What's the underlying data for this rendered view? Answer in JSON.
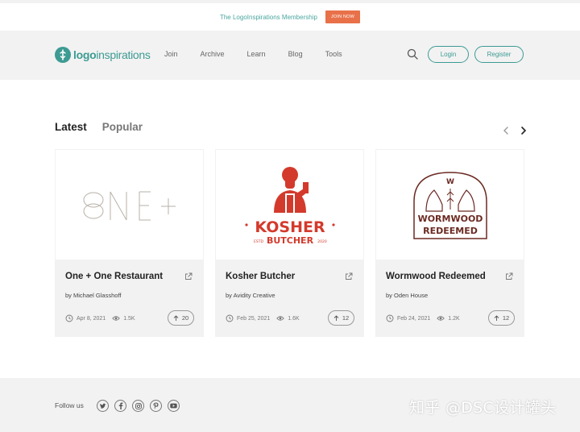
{
  "promo": {
    "text": "The LogoInspirations Membership",
    "button": "JOIN NOW"
  },
  "header": {
    "logo_part1": "logo",
    "logo_part2": "inspirations",
    "nav": [
      "Join",
      "Archive",
      "Learn",
      "Blog",
      "Tools"
    ],
    "login": "Login",
    "register": "Register"
  },
  "tabs": {
    "latest": "Latest",
    "popular": "Popular"
  },
  "cards": [
    {
      "title": "One + One Restaurant",
      "author": "by Michael Glasshoff",
      "date": "Apr 8, 2021",
      "views": "1.5K",
      "votes": "20",
      "logo_text": "ONE+"
    },
    {
      "title": "Kosher Butcher",
      "author": "by Avidity Creative",
      "date": "Feb 25, 2021",
      "views": "1.6K",
      "votes": "12",
      "logo_word": "KOSHER",
      "logo_sub": "BUTCHER",
      "logo_left": "ESTD",
      "logo_right": "2020"
    },
    {
      "title": "Wormwood Redeemed",
      "author": "by Oden House",
      "date": "Feb 24, 2021",
      "views": "1.2K",
      "votes": "12",
      "logo_line1": "WORMWOOD",
      "logo_line2": "REDEEMED",
      "logo_badge": "W"
    }
  ],
  "footer": {
    "follow": "Follow us",
    "watermark": "知乎 @DSC设计罐头"
  },
  "colors": {
    "accent": "#3d9b93",
    "promo_button": "#e8714a",
    "kosher_red": "#d33a2c",
    "wormwood_brown": "#6b2a22"
  },
  "icons": [
    "search-icon",
    "chevron-left-icon",
    "chevron-right-icon",
    "external-link-icon",
    "clock-icon",
    "eye-icon",
    "arrow-up-icon",
    "twitter-icon",
    "facebook-icon",
    "instagram-icon",
    "pinterest-icon",
    "youtube-icon"
  ]
}
